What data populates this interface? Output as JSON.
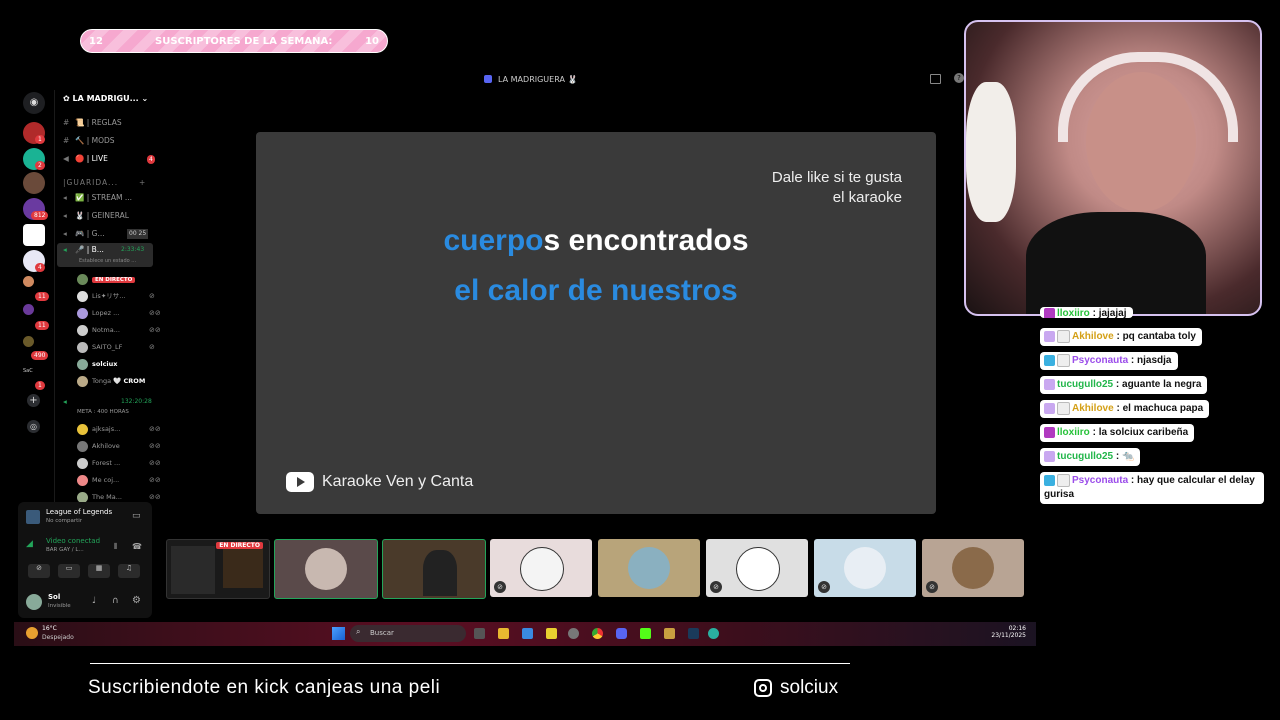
{
  "sub_goal": {
    "left": "12",
    "label": "SUSCRIPTORES DE LA SEMANA:",
    "right": "10"
  },
  "discord": {
    "window_title": "LA MADRIGUERA 🐰",
    "server_name": "LA MADRIGU...",
    "guild_badges": [
      "1",
      "2",
      "812",
      "4",
      "11",
      "11",
      "490",
      "1"
    ],
    "guild_label": "SaC",
    "channels": [
      {
        "icon": "#",
        "name": "📜 | REGLAS"
      },
      {
        "icon": "#",
        "name": "🔨 | MODS"
      },
      {
        "icon": "📢",
        "name": "🔴 | LIVE",
        "badge": "4"
      },
      {
        "icon": "",
        "name": "|GUARIDA..."
      },
      {
        "icon": "🔊",
        "name": "✅ | STREAM ..."
      },
      {
        "icon": "🔊",
        "name": "🐰 | GEINERAL"
      },
      {
        "icon": "🔊",
        "name": "🎮 | G...",
        "extra": "00 25"
      },
      {
        "icon": "🔊",
        "name": "🎤 | B...",
        "extra": "2:33:43"
      }
    ],
    "status_line": "Establece un estado ...",
    "live_badge": "EN DIRECTO",
    "voice_users_a": [
      "Lis✦リサ...",
      "Lopez ...",
      "Notma...",
      "SAITO_LF",
      "solciux",
      "Tonga"
    ],
    "crom_label": "🤍 CROM",
    "second_channel_time": "132:20:28",
    "meta_label": "META : 400 HORAS",
    "voice_users_b": [
      "ajksajs...",
      "Akhilove",
      "Forest ...",
      "Me coj...",
      "The Ma..."
    ],
    "activity": {
      "game": "League of Legends",
      "status": "No compartir"
    },
    "voice": {
      "title": "Video conectad",
      "sub": "BAR GAY / L..."
    },
    "me": {
      "name": "Sol",
      "status": "Invisible"
    }
  },
  "player": {
    "like_line1": "Dale like si te gusta",
    "like_line2": "el karaoke",
    "lyric1_sung": "cuerpo",
    "lyric1_rest": "s encontrados",
    "lyric2": "el calor de nuestros",
    "channel": "Karaoke Ven y Canta"
  },
  "tiles_live_badge": "EN DIRECTO",
  "taskbar": {
    "temp": "16°C",
    "weather": "Despejado",
    "search": "Buscar",
    "time": "02:16",
    "date": "23/11/2025"
  },
  "chat": [
    {
      "user": "lloxiiro",
      "text": "jajajaj",
      "color": "#27c23a"
    },
    {
      "user": "Akhilove",
      "text": "pq cantaba toly",
      "color": "#d4a017"
    },
    {
      "user": "Psyconauta",
      "text": "njasdja",
      "color": "#9b4dea"
    },
    {
      "user": "tucugullo25",
      "text": "aguante la negra",
      "color": "#22b64a"
    },
    {
      "user": "Akhilove",
      "text": "el machuca papa",
      "color": "#d4a017"
    },
    {
      "user": "lloxiiro",
      "text": "la solciux caribeña",
      "color": "#27c23a"
    },
    {
      "user": "tucugullo25",
      "text": "🐀",
      "color": "#22b64a"
    },
    {
      "user": "Psyconauta",
      "text": "hay que calcular el delay",
      "text2": "gurisa",
      "color": "#9b4dea"
    }
  ],
  "footer": {
    "left": "Suscribiendote en kick canjeas una peli",
    "right": "solciux"
  }
}
